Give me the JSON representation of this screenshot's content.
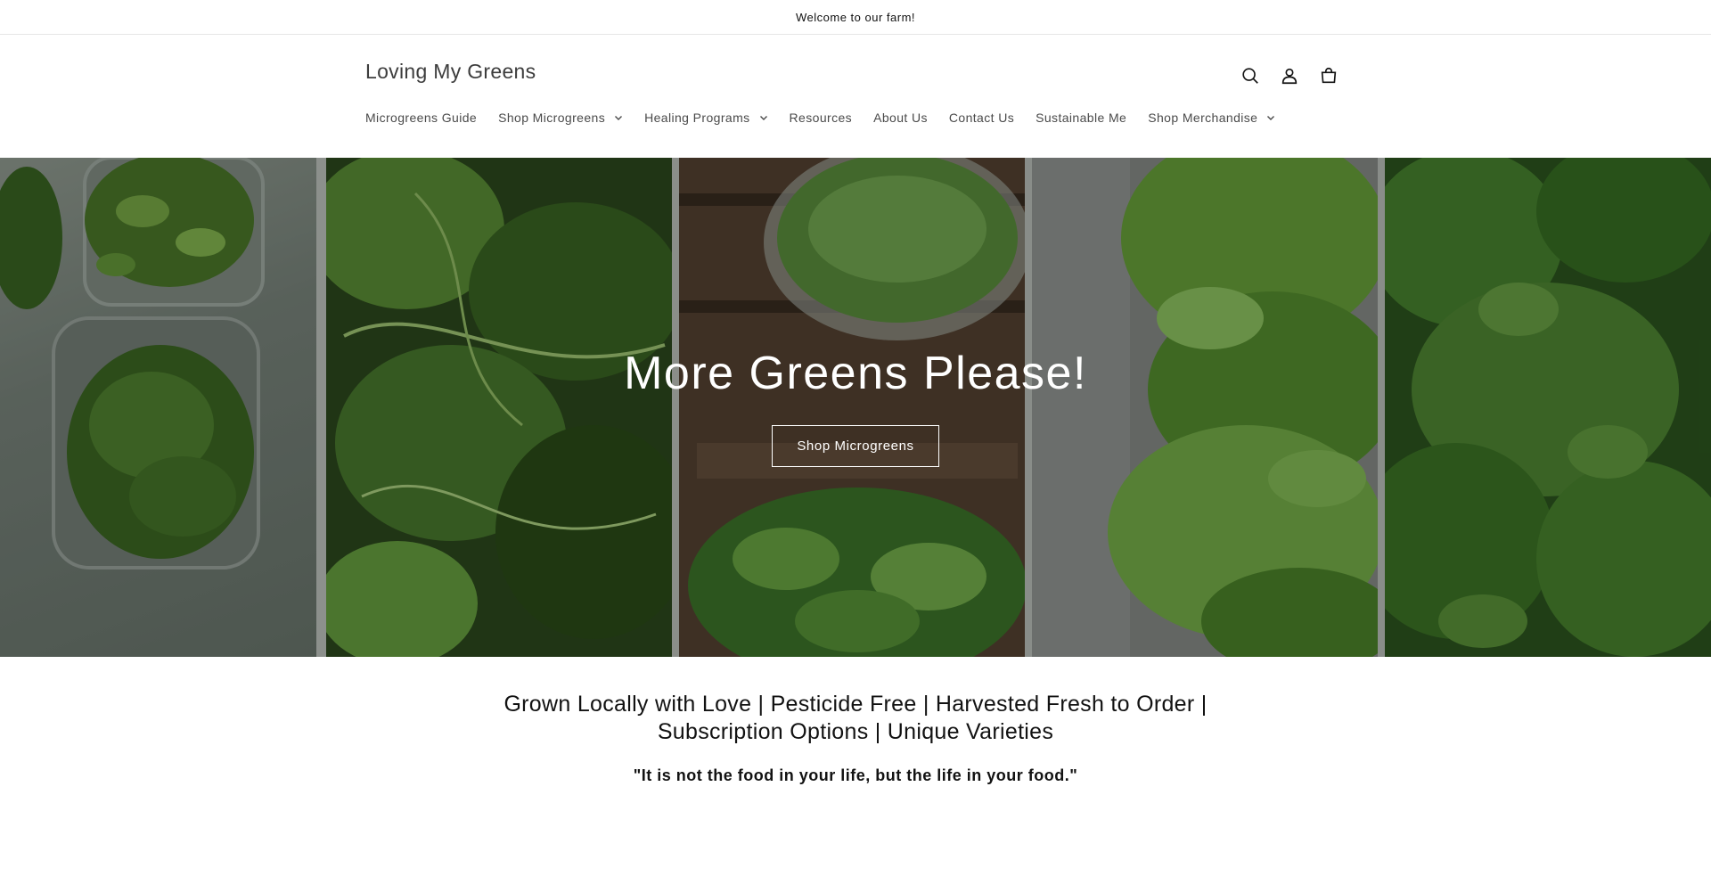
{
  "announcement": {
    "text": "Welcome to our farm!"
  },
  "header": {
    "logo": "Loving My Greens",
    "icons": [
      "search-icon",
      "account-icon",
      "cart-icon"
    ]
  },
  "nav": {
    "items": [
      {
        "label": "Microgreens Guide",
        "has_dropdown": false
      },
      {
        "label": "Shop Microgreens",
        "has_dropdown": true
      },
      {
        "label": "Healing Programs",
        "has_dropdown": true
      },
      {
        "label": "Resources",
        "has_dropdown": false
      },
      {
        "label": "About Us",
        "has_dropdown": false
      },
      {
        "label": "Contact Us",
        "has_dropdown": false
      },
      {
        "label": "Sustainable Me",
        "has_dropdown": false
      },
      {
        "label": "Shop Merchandise",
        "has_dropdown": true
      }
    ]
  },
  "hero": {
    "title": "More Greens Please!",
    "button_label": "Shop Microgreens"
  },
  "content": {
    "tagline": "Grown Locally with Love | Pesticide Free | Harvested Fresh to Order | Subscription Options | Unique Varieties",
    "quote": "\"It is not the food in your life, but the life in your food.\""
  },
  "colors": {
    "text": "#121212",
    "nav_text": "#4a4a4a",
    "logo": "#3d3d3d",
    "border": "#e6e6e6",
    "hero_button_border": "#ffffff"
  }
}
